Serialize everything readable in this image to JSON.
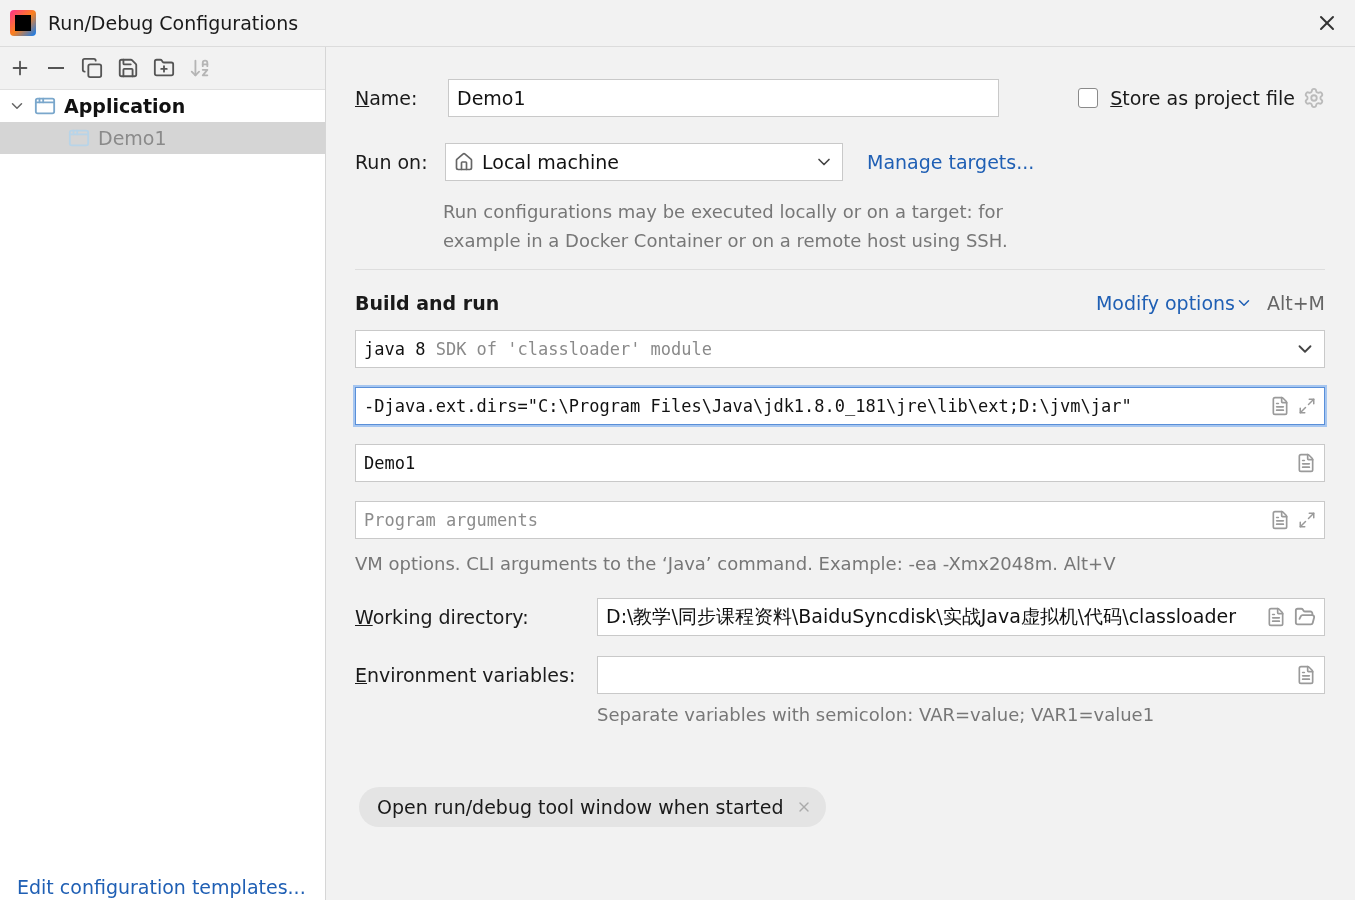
{
  "window": {
    "title": "Run/Debug Configurations"
  },
  "toolbar": [
    {
      "kind": "add",
      "disabled": false
    },
    {
      "kind": "remove",
      "disabled": false
    },
    {
      "kind": "copy",
      "disabled": false
    },
    {
      "kind": "save",
      "disabled": false
    },
    {
      "kind": "folder",
      "disabled": false
    },
    {
      "kind": "sort",
      "disabled": true
    }
  ],
  "tree": [
    {
      "label": "Application",
      "expanded": true,
      "selected": false,
      "children": [
        {
          "label": "Demo1",
          "selected": true
        }
      ]
    }
  ],
  "templates_link": "Edit configuration templates...",
  "name": {
    "label": "Name:",
    "value": "Demo1"
  },
  "store_as_project_file": {
    "label": "Store as project file",
    "checked": false
  },
  "run_on": {
    "label": "Run on:",
    "value": "Local machine",
    "link": "Manage targets..."
  },
  "run_on_hint": "Run configurations may be executed locally or on a target: for example in a Docker Container or on a remote host using SSH.",
  "build_and_run": {
    "title": "Build and run",
    "modify_options": "Modify options",
    "shortcut": "Alt+M",
    "sdk": {
      "value": "java 8",
      "hint": "SDK of 'classloader' module"
    },
    "vm_options": {
      "value": "-Djava.ext.dirs=\"C:\\Program Files\\Java\\jdk1.8.0_181\\jre\\lib\\ext;D:\\jvm\\jar\"",
      "focused": true
    },
    "main_class": {
      "value": "Demo1",
      "focused": false
    },
    "program_arguments": {
      "placeholder": "Program arguments",
      "focused": false
    },
    "hint": "VM options. CLI arguments to the ‘Java’ command. Example: -ea -Xmx2048m. Alt+V"
  },
  "working_directory": {
    "label": "Working directory:",
    "value": "D:\\教学\\同步课程资料\\BaiduSyncdisk\\实战Java虚拟机\\代码\\classloader"
  },
  "environment_variables": {
    "label": "Environment variables:",
    "hint": "Separate variables with semicolon: VAR=value; VAR1=value1"
  },
  "tags": [
    {
      "label": "Open run/debug tool window when started"
    }
  ]
}
